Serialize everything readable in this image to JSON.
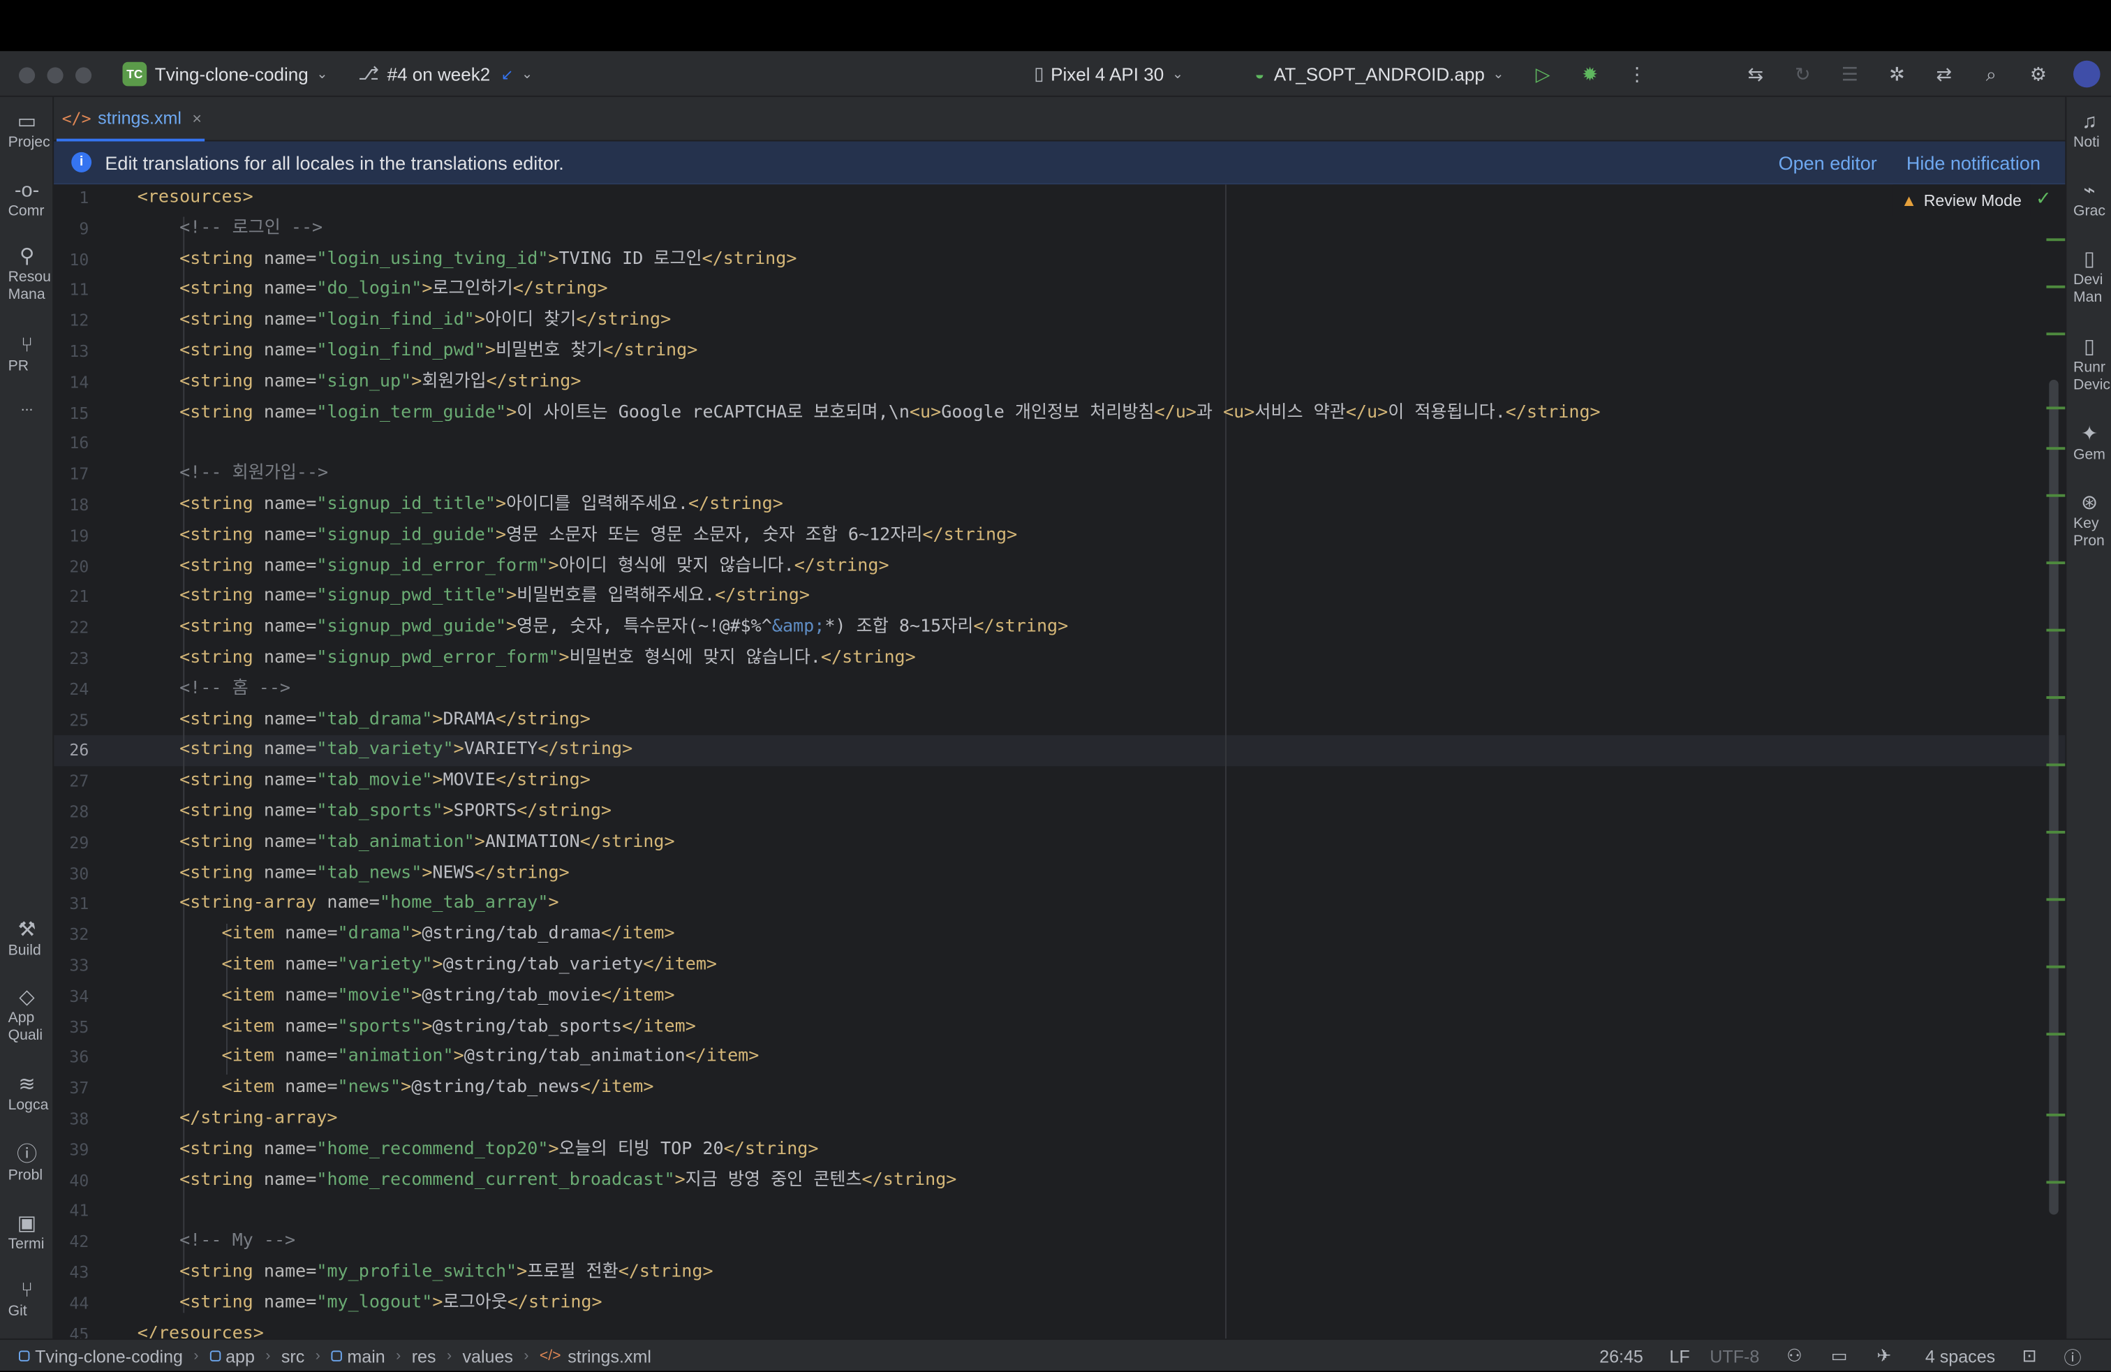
{
  "titlebar": {
    "project_badge": "TC",
    "project_name": "Tving-clone-coding",
    "branch": "#4 on week2",
    "device": "Pixel 4 API 30",
    "run_config": "AT_SOPT_ANDROID.app"
  },
  "left_tools": [
    {
      "name": "project",
      "icon": "folder-icon",
      "label": "Projec"
    },
    {
      "name": "commit",
      "icon": "commit-icon",
      "label": "Comr"
    },
    {
      "name": "resource-manager",
      "icon": "resource-icon",
      "label": "Resou\nMana"
    },
    {
      "name": "pull-requests",
      "icon": "pull-request-icon",
      "label": "PR"
    },
    {
      "name": "more",
      "icon": "more-icon",
      "label": "..."
    },
    {
      "name": "build",
      "icon": "hammer-icon",
      "label": "Build"
    },
    {
      "name": "app-quality",
      "icon": "diamond-icon",
      "label": "App\nQuali"
    },
    {
      "name": "logcat",
      "icon": "logcat-icon",
      "label": "Logca"
    },
    {
      "name": "problems",
      "icon": "problems-icon",
      "label": "Probl"
    },
    {
      "name": "terminal",
      "icon": "terminal-icon",
      "label": "Termi"
    },
    {
      "name": "git",
      "icon": "git-icon",
      "label": "Git"
    }
  ],
  "right_tools": [
    {
      "name": "notifications",
      "icon": "bell-icon",
      "label": "Noti"
    },
    {
      "name": "gradle",
      "icon": "gradle-icon",
      "label": "Grac"
    },
    {
      "name": "device-manager",
      "icon": "device-icon",
      "label": "Devi\nMan"
    },
    {
      "name": "running-devices",
      "icon": "running-device-icon",
      "label": "Runr\nDevic"
    },
    {
      "name": "gemini",
      "icon": "sparkle-icon",
      "label": "Gem"
    },
    {
      "name": "key-promoter",
      "icon": "key-icon",
      "label": "Key\nPron"
    }
  ],
  "tab": {
    "label": "strings.xml"
  },
  "notification": {
    "message": "Edit translations for all locales in the translations editor.",
    "open_editor": "Open editor",
    "hide": "Hide notification"
  },
  "editor": {
    "review_mode": "Review Mode",
    "current_line": 26,
    "lines": [
      {
        "n": "1",
        "tokens": [
          [
            "t",
            "<resources>"
          ]
        ]
      },
      {
        "n": "9",
        "tokens": [
          [
            "c",
            "    <!-- 로그인 -->"
          ]
        ]
      },
      {
        "n": "10",
        "tokens": [
          [
            "p",
            "    "
          ],
          [
            "t",
            "<string "
          ],
          [
            "a",
            "name="
          ],
          [
            "v",
            "\"login_using_tving_id\""
          ],
          [
            "t",
            ">"
          ],
          [
            "p",
            "TVING ID 로그인"
          ],
          [
            "t",
            "</string>"
          ]
        ]
      },
      {
        "n": "11",
        "tokens": [
          [
            "p",
            "    "
          ],
          [
            "t",
            "<string "
          ],
          [
            "a",
            "name="
          ],
          [
            "v",
            "\"do_login\""
          ],
          [
            "t",
            ">"
          ],
          [
            "p",
            "로그인하기"
          ],
          [
            "t",
            "</string>"
          ]
        ]
      },
      {
        "n": "12",
        "tokens": [
          [
            "p",
            "    "
          ],
          [
            "t",
            "<string "
          ],
          [
            "a",
            "name="
          ],
          [
            "v",
            "\"login_find_id\""
          ],
          [
            "t",
            ">"
          ],
          [
            "p",
            "아이디 찾기"
          ],
          [
            "t",
            "</string>"
          ]
        ]
      },
      {
        "n": "13",
        "tokens": [
          [
            "p",
            "    "
          ],
          [
            "t",
            "<string "
          ],
          [
            "a",
            "name="
          ],
          [
            "v",
            "\"login_find_pwd\""
          ],
          [
            "t",
            ">"
          ],
          [
            "p",
            "비밀번호 찾기"
          ],
          [
            "t",
            "</string>"
          ]
        ]
      },
      {
        "n": "14",
        "tokens": [
          [
            "p",
            "    "
          ],
          [
            "t",
            "<string "
          ],
          [
            "a",
            "name="
          ],
          [
            "v",
            "\"sign_up\""
          ],
          [
            "t",
            ">"
          ],
          [
            "p",
            "회원가입"
          ],
          [
            "t",
            "</string>"
          ]
        ]
      },
      {
        "n": "15",
        "tokens": [
          [
            "p",
            "    "
          ],
          [
            "t",
            "<string "
          ],
          [
            "a",
            "name="
          ],
          [
            "v",
            "\"login_term_guide\""
          ],
          [
            "t",
            ">"
          ],
          [
            "p",
            "이 사이트는 Google reCAPTCHA로 보호되며,\\n"
          ],
          [
            "t",
            "<u>"
          ],
          [
            "p",
            "Google 개인정보 처리방침"
          ],
          [
            "t",
            "</u>"
          ],
          [
            "p",
            "과 "
          ],
          [
            "t",
            "<u>"
          ],
          [
            "p",
            "서비스 약관"
          ],
          [
            "t",
            "</u>"
          ],
          [
            "p",
            "이 적용됩니다."
          ],
          [
            "t",
            "</string>"
          ]
        ]
      },
      {
        "n": "16",
        "tokens": []
      },
      {
        "n": "17",
        "tokens": [
          [
            "c",
            "    <!-- 회원가입-->"
          ]
        ]
      },
      {
        "n": "18",
        "tokens": [
          [
            "p",
            "    "
          ],
          [
            "t",
            "<string "
          ],
          [
            "a",
            "name="
          ],
          [
            "v",
            "\"signup_id_title\""
          ],
          [
            "t",
            ">"
          ],
          [
            "p",
            "아이디를 입력해주세요."
          ],
          [
            "t",
            "</string>"
          ]
        ]
      },
      {
        "n": "19",
        "tokens": [
          [
            "p",
            "    "
          ],
          [
            "t",
            "<string "
          ],
          [
            "a",
            "name="
          ],
          [
            "v",
            "\"signup_id_guide\""
          ],
          [
            "t",
            ">"
          ],
          [
            "p",
            "영문 소문자 또는 영문 소문자, 숫자 조합 6~12자리"
          ],
          [
            "t",
            "</string>"
          ]
        ]
      },
      {
        "n": "20",
        "tokens": [
          [
            "p",
            "    "
          ],
          [
            "t",
            "<string "
          ],
          [
            "a",
            "name="
          ],
          [
            "v",
            "\"signup_id_error_form\""
          ],
          [
            "t",
            ">"
          ],
          [
            "p",
            "아이디 형식에 맞지 않습니다."
          ],
          [
            "t",
            "</string>"
          ]
        ]
      },
      {
        "n": "21",
        "tokens": [
          [
            "p",
            "    "
          ],
          [
            "t",
            "<string "
          ],
          [
            "a",
            "name="
          ],
          [
            "v",
            "\"signup_pwd_title\""
          ],
          [
            "t",
            ">"
          ],
          [
            "p",
            "비밀번호를 입력해주세요."
          ],
          [
            "t",
            "</string>"
          ]
        ]
      },
      {
        "n": "22",
        "tokens": [
          [
            "p",
            "    "
          ],
          [
            "t",
            "<string "
          ],
          [
            "a",
            "name="
          ],
          [
            "v",
            "\"signup_pwd_guide\""
          ],
          [
            "t",
            ">"
          ],
          [
            "p",
            "영문, 숫자, 특수문자(~!@#$%^"
          ],
          [
            "e",
            "&amp;"
          ],
          [
            "p",
            "*) 조합 8~15자리"
          ],
          [
            "t",
            "</string>"
          ]
        ]
      },
      {
        "n": "23",
        "tokens": [
          [
            "p",
            "    "
          ],
          [
            "t",
            "<string "
          ],
          [
            "a",
            "name="
          ],
          [
            "v",
            "\"signup_pwd_error_form\""
          ],
          [
            "t",
            ">"
          ],
          [
            "p",
            "비밀번호 형식에 맞지 않습니다."
          ],
          [
            "t",
            "</string>"
          ]
        ]
      },
      {
        "n": "24",
        "tokens": [
          [
            "c",
            "    <!-- 홈 -->"
          ]
        ]
      },
      {
        "n": "25",
        "tokens": [
          [
            "p",
            "    "
          ],
          [
            "t",
            "<string "
          ],
          [
            "a",
            "name="
          ],
          [
            "v",
            "\"tab_drama\""
          ],
          [
            "t",
            ">"
          ],
          [
            "p",
            "DRAMA"
          ],
          [
            "t",
            "</string>"
          ]
        ]
      },
      {
        "n": "26",
        "tokens": [
          [
            "p",
            "    "
          ],
          [
            "t",
            "<string "
          ],
          [
            "a",
            "name="
          ],
          [
            "v",
            "\"tab_variety\""
          ],
          [
            "t",
            ">"
          ],
          [
            "p",
            "VARIETY"
          ],
          [
            "t",
            "</string>"
          ]
        ]
      },
      {
        "n": "27",
        "tokens": [
          [
            "p",
            "    "
          ],
          [
            "t",
            "<string "
          ],
          [
            "a",
            "name="
          ],
          [
            "v",
            "\"tab_movie\""
          ],
          [
            "t",
            ">"
          ],
          [
            "p",
            "MOVIE"
          ],
          [
            "t",
            "</string>"
          ]
        ]
      },
      {
        "n": "28",
        "tokens": [
          [
            "p",
            "    "
          ],
          [
            "t",
            "<string "
          ],
          [
            "a",
            "name="
          ],
          [
            "v",
            "\"tab_sports\""
          ],
          [
            "t",
            ">"
          ],
          [
            "p",
            "SPORTS"
          ],
          [
            "t",
            "</string>"
          ]
        ]
      },
      {
        "n": "29",
        "tokens": [
          [
            "p",
            "    "
          ],
          [
            "t",
            "<string "
          ],
          [
            "a",
            "name="
          ],
          [
            "v",
            "\"tab_animation\""
          ],
          [
            "t",
            ">"
          ],
          [
            "p",
            "ANIMATION"
          ],
          [
            "t",
            "</string>"
          ]
        ]
      },
      {
        "n": "30",
        "tokens": [
          [
            "p",
            "    "
          ],
          [
            "t",
            "<string "
          ],
          [
            "a",
            "name="
          ],
          [
            "v",
            "\"tab_news\""
          ],
          [
            "t",
            ">"
          ],
          [
            "p",
            "NEWS"
          ],
          [
            "t",
            "</string>"
          ]
        ]
      },
      {
        "n": "31",
        "tokens": [
          [
            "p",
            "    "
          ],
          [
            "t",
            "<string-array "
          ],
          [
            "a",
            "name="
          ],
          [
            "v",
            "\"home_tab_array\""
          ],
          [
            "t",
            ">"
          ]
        ]
      },
      {
        "n": "32",
        "tokens": [
          [
            "p",
            "        "
          ],
          [
            "t",
            "<item "
          ],
          [
            "a",
            "name="
          ],
          [
            "v",
            "\"drama\""
          ],
          [
            "t",
            ">"
          ],
          [
            "p",
            "@string/tab_drama"
          ],
          [
            "t",
            "</item>"
          ]
        ]
      },
      {
        "n": "33",
        "tokens": [
          [
            "p",
            "        "
          ],
          [
            "t",
            "<item "
          ],
          [
            "a",
            "name="
          ],
          [
            "v",
            "\"variety\""
          ],
          [
            "t",
            ">"
          ],
          [
            "p",
            "@string/tab_variety"
          ],
          [
            "t",
            "</item>"
          ]
        ]
      },
      {
        "n": "34",
        "tokens": [
          [
            "p",
            "        "
          ],
          [
            "t",
            "<item "
          ],
          [
            "a",
            "name="
          ],
          [
            "v",
            "\"movie\""
          ],
          [
            "t",
            ">"
          ],
          [
            "p",
            "@string/tab_movie"
          ],
          [
            "t",
            "</item>"
          ]
        ]
      },
      {
        "n": "35",
        "tokens": [
          [
            "p",
            "        "
          ],
          [
            "t",
            "<item "
          ],
          [
            "a",
            "name="
          ],
          [
            "v",
            "\"sports\""
          ],
          [
            "t",
            ">"
          ],
          [
            "p",
            "@string/tab_sports"
          ],
          [
            "t",
            "</item>"
          ]
        ]
      },
      {
        "n": "36",
        "tokens": [
          [
            "p",
            "        "
          ],
          [
            "t",
            "<item "
          ],
          [
            "a",
            "name="
          ],
          [
            "v",
            "\"animation\""
          ],
          [
            "t",
            ">"
          ],
          [
            "p",
            "@string/tab_animation"
          ],
          [
            "t",
            "</item>"
          ]
        ]
      },
      {
        "n": "37",
        "tokens": [
          [
            "p",
            "        "
          ],
          [
            "t",
            "<item "
          ],
          [
            "a",
            "name="
          ],
          [
            "v",
            "\"news\""
          ],
          [
            "t",
            ">"
          ],
          [
            "p",
            "@string/tab_news"
          ],
          [
            "t",
            "</item>"
          ]
        ]
      },
      {
        "n": "38",
        "tokens": [
          [
            "p",
            "    "
          ],
          [
            "t",
            "</string-array>"
          ]
        ]
      },
      {
        "n": "39",
        "tokens": [
          [
            "p",
            "    "
          ],
          [
            "t",
            "<string "
          ],
          [
            "a",
            "name="
          ],
          [
            "v",
            "\"home_recommend_top20\""
          ],
          [
            "t",
            ">"
          ],
          [
            "p",
            "오늘의 티빙 TOP 20"
          ],
          [
            "t",
            "</string>"
          ]
        ]
      },
      {
        "n": "40",
        "tokens": [
          [
            "p",
            "    "
          ],
          [
            "t",
            "<string "
          ],
          [
            "a",
            "name="
          ],
          [
            "v",
            "\"home_recommend_current_broadcast\""
          ],
          [
            "t",
            ">"
          ],
          [
            "p",
            "지금 방영 중인 콘텐츠"
          ],
          [
            "t",
            "</string>"
          ]
        ]
      },
      {
        "n": "41",
        "tokens": []
      },
      {
        "n": "42",
        "tokens": [
          [
            "c",
            "    <!-- My -->"
          ]
        ]
      },
      {
        "n": "43",
        "tokens": [
          [
            "p",
            "    "
          ],
          [
            "t",
            "<string "
          ],
          [
            "a",
            "name="
          ],
          [
            "v",
            "\"my_profile_switch\""
          ],
          [
            "t",
            ">"
          ],
          [
            "p",
            "프로필 전환"
          ],
          [
            "t",
            "</string>"
          ]
        ]
      },
      {
        "n": "44",
        "tokens": [
          [
            "p",
            "    "
          ],
          [
            "t",
            "<string "
          ],
          [
            "a",
            "name="
          ],
          [
            "v",
            "\"my_logout\""
          ],
          [
            "t",
            ">"
          ],
          [
            "p",
            "로그아웃"
          ],
          [
            "t",
            "</string>"
          ]
        ]
      },
      {
        "n": "45",
        "tokens": [
          [
            "t",
            "</resources>"
          ]
        ]
      }
    ]
  },
  "statusbar": {
    "breadcrumbs": [
      "Tving-clone-coding",
      "app",
      "src",
      "main",
      "res",
      "values",
      "strings.xml"
    ],
    "position": "26:45",
    "line_ending": "LF",
    "encoding": "UTF-8",
    "indent": "4 spaces"
  },
  "colors": {
    "tag": "#d5b778",
    "attribute": "#bababa",
    "value": "#6aab73",
    "comment": "#7a7e85",
    "accent": "#3574f0"
  }
}
